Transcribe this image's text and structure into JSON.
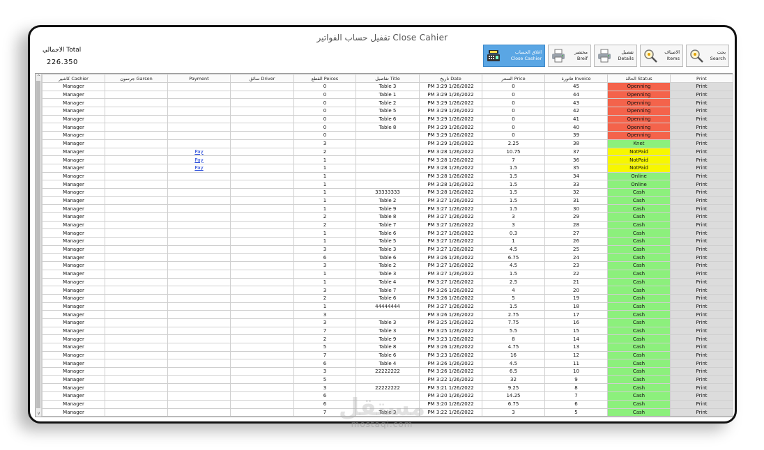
{
  "window": {
    "title": "تقفيل حساب الفواتير Close Cahier"
  },
  "total": {
    "label": "الاجمالي Total",
    "value": "226.350"
  },
  "toolbar": {
    "close_cashier": {
      "ar": "اغلاق الحساب",
      "en": "Close Cashier"
    },
    "brief": {
      "ar": "مختصر",
      "en": "Breif"
    },
    "details": {
      "ar": "تفصيل",
      "en": "Details"
    },
    "items": {
      "ar": "الاصناف",
      "en": "Items"
    },
    "search": {
      "ar": "بحث",
      "en": "Search"
    }
  },
  "scroll": {
    "up": "^",
    "down": "v"
  },
  "columns": [
    "كاشير Cashier",
    "جرسون Garson",
    "Payment",
    "سائق Driver",
    "القطع Peices",
    "تفاصيل Title",
    "تاريخ Date",
    "السعر Price",
    "فاتورة Invoice",
    "الحالة Status",
    "Print"
  ],
  "rows": [
    {
      "cashier": "Manager",
      "garson": "",
      "payment": "",
      "driver": "",
      "pieces": "0",
      "title": "Table 3",
      "date": "PM 3:29 1/26/2022",
      "price": "0",
      "invoice": "45",
      "status": "Openning",
      "print": "Print"
    },
    {
      "cashier": "Manager",
      "garson": "",
      "payment": "",
      "driver": "",
      "pieces": "0",
      "title": "Table 1",
      "date": "PM 3:29 1/26/2022",
      "price": "0",
      "invoice": "44",
      "status": "Openning",
      "print": "Print"
    },
    {
      "cashier": "Manager",
      "garson": "",
      "payment": "",
      "driver": "",
      "pieces": "0",
      "title": "Table 2",
      "date": "PM 3:29 1/26/2022",
      "price": "0",
      "invoice": "43",
      "status": "Openning",
      "print": "Print"
    },
    {
      "cashier": "Manager",
      "garson": "",
      "payment": "",
      "driver": "",
      "pieces": "0",
      "title": "Table 5",
      "date": "PM 3:29 1/26/2022",
      "price": "0",
      "invoice": "42",
      "status": "Openning",
      "print": "Print"
    },
    {
      "cashier": "Manager",
      "garson": "",
      "payment": "",
      "driver": "",
      "pieces": "0",
      "title": "Table 6",
      "date": "PM 3:29 1/26/2022",
      "price": "0",
      "invoice": "41",
      "status": "Openning",
      "print": "Print"
    },
    {
      "cashier": "Manager",
      "garson": "",
      "payment": "",
      "driver": "",
      "pieces": "0",
      "title": "Table 8",
      "date": "PM 3:29 1/26/2022",
      "price": "0",
      "invoice": "40",
      "status": "Openning",
      "print": "Print"
    },
    {
      "cashier": "Manager",
      "garson": "",
      "payment": "",
      "driver": "",
      "pieces": "0",
      "title": "",
      "date": "PM 3:29 1/26/2022",
      "price": "0",
      "invoice": "39",
      "status": "Openning",
      "print": "Print"
    },
    {
      "cashier": "Manager",
      "garson": "",
      "payment": "",
      "driver": "",
      "pieces": "3",
      "title": "",
      "date": "PM 3:29 1/26/2022",
      "price": "2.25",
      "invoice": "38",
      "status": "Knet",
      "print": "Print"
    },
    {
      "cashier": "Manager",
      "garson": "",
      "payment": "Pay",
      "driver": "",
      "pieces": "2",
      "title": "",
      "date": "PM 3:28 1/26/2022",
      "price": "10.75",
      "invoice": "37",
      "status": "NotPaid",
      "print": "Print"
    },
    {
      "cashier": "Manager",
      "garson": "",
      "payment": "Pay",
      "driver": "",
      "pieces": "1",
      "title": "",
      "date": "PM 3:28 1/26/2022",
      "price": "7",
      "invoice": "36",
      "status": "NotPaid",
      "print": "Print"
    },
    {
      "cashier": "Manager",
      "garson": "",
      "payment": "Pay",
      "driver": "",
      "pieces": "1",
      "title": "",
      "date": "PM 3:28 1/26/2022",
      "price": "1.5",
      "invoice": "35",
      "status": "NotPaid",
      "print": "Print"
    },
    {
      "cashier": "Manager",
      "garson": "",
      "payment": "",
      "driver": "",
      "pieces": "1",
      "title": "",
      "date": "PM 3:28 1/26/2022",
      "price": "1.5",
      "invoice": "34",
      "status": "Online",
      "print": "Print"
    },
    {
      "cashier": "Manager",
      "garson": "",
      "payment": "",
      "driver": "",
      "pieces": "1",
      "title": "",
      "date": "PM 3:28 1/26/2022",
      "price": "1.5",
      "invoice": "33",
      "status": "Online",
      "print": "Print"
    },
    {
      "cashier": "Manager",
      "garson": "",
      "payment": "",
      "driver": "",
      "pieces": "1",
      "title": "33333333",
      "date": "PM 3:28 1/26/2022",
      "price": "1.5",
      "invoice": "32",
      "status": "Cash",
      "print": "Print"
    },
    {
      "cashier": "Manager",
      "garson": "",
      "payment": "",
      "driver": "",
      "pieces": "1",
      "title": "Table 2",
      "date": "PM 3:27 1/26/2022",
      "price": "1.5",
      "invoice": "31",
      "status": "Cash",
      "print": "Print"
    },
    {
      "cashier": "Manager",
      "garson": "",
      "payment": "",
      "driver": "",
      "pieces": "1",
      "title": "Table 9",
      "date": "PM 3:27 1/26/2022",
      "price": "1.5",
      "invoice": "30",
      "status": "Cash",
      "print": "Print"
    },
    {
      "cashier": "Manager",
      "garson": "",
      "payment": "",
      "driver": "",
      "pieces": "2",
      "title": "Table 8",
      "date": "PM 3:27 1/26/2022",
      "price": "3",
      "invoice": "29",
      "status": "Cash",
      "print": "Print"
    },
    {
      "cashier": "Manager",
      "garson": "",
      "payment": "",
      "driver": "",
      "pieces": "2",
      "title": "Table 7",
      "date": "PM 3:27 1/26/2022",
      "price": "3",
      "invoice": "28",
      "status": "Cash",
      "print": "Print"
    },
    {
      "cashier": "Manager",
      "garson": "",
      "payment": "",
      "driver": "",
      "pieces": "1",
      "title": "Table 6",
      "date": "PM 3:27 1/26/2022",
      "price": "0.3",
      "invoice": "27",
      "status": "Cash",
      "print": "Print"
    },
    {
      "cashier": "Manager",
      "garson": "",
      "payment": "",
      "driver": "",
      "pieces": "1",
      "title": "Table 5",
      "date": "PM 3:27 1/26/2022",
      "price": "1",
      "invoice": "26",
      "status": "Cash",
      "print": "Print"
    },
    {
      "cashier": "Manager",
      "garson": "",
      "payment": "",
      "driver": "",
      "pieces": "3",
      "title": "Table 3",
      "date": "PM 3:27 1/26/2022",
      "price": "4.5",
      "invoice": "25",
      "status": "Cash",
      "print": "Print"
    },
    {
      "cashier": "Manager",
      "garson": "",
      "payment": "",
      "driver": "",
      "pieces": "6",
      "title": "Table 6",
      "date": "PM 3:26 1/26/2022",
      "price": "6.75",
      "invoice": "24",
      "status": "Cash",
      "print": "Print"
    },
    {
      "cashier": "Manager",
      "garson": "",
      "payment": "",
      "driver": "",
      "pieces": "3",
      "title": "Table 2",
      "date": "PM 3:27 1/26/2022",
      "price": "4.5",
      "invoice": "23",
      "status": "Cash",
      "print": "Print"
    },
    {
      "cashier": "Manager",
      "garson": "",
      "payment": "",
      "driver": "",
      "pieces": "1",
      "title": "Table 3",
      "date": "PM 3:27 1/26/2022",
      "price": "1.5",
      "invoice": "22",
      "status": "Cash",
      "print": "Print"
    },
    {
      "cashier": "Manager",
      "garson": "",
      "payment": "",
      "driver": "",
      "pieces": "1",
      "title": "Table 4",
      "date": "PM 3:27 1/26/2022",
      "price": "2.5",
      "invoice": "21",
      "status": "Cash",
      "print": "Print"
    },
    {
      "cashier": "Manager",
      "garson": "",
      "payment": "",
      "driver": "",
      "pieces": "3",
      "title": "Table 7",
      "date": "PM 3:26 1/26/2022",
      "price": "4",
      "invoice": "20",
      "status": "Cash",
      "print": "Print"
    },
    {
      "cashier": "Manager",
      "garson": "",
      "payment": "",
      "driver": "",
      "pieces": "2",
      "title": "Table 6",
      "date": "PM 3:26 1/26/2022",
      "price": "5",
      "invoice": "19",
      "status": "Cash",
      "print": "Print"
    },
    {
      "cashier": "Manager",
      "garson": "",
      "payment": "",
      "driver": "",
      "pieces": "1",
      "title": "44444444",
      "date": "PM 3:27 1/26/2022",
      "price": "1.5",
      "invoice": "18",
      "status": "Cash",
      "print": "Print"
    },
    {
      "cashier": "Manager",
      "garson": "",
      "payment": "",
      "driver": "",
      "pieces": "3",
      "title": "",
      "date": "PM 3:26 1/26/2022",
      "price": "2.75",
      "invoice": "17",
      "status": "Cash",
      "print": "Print"
    },
    {
      "cashier": "Manager",
      "garson": "",
      "payment": "",
      "driver": "",
      "pieces": "3",
      "title": "Table 3",
      "date": "PM 3:25 1/26/2022",
      "price": "7.75",
      "invoice": "16",
      "status": "Cash",
      "print": "Print"
    },
    {
      "cashier": "Manager",
      "garson": "",
      "payment": "",
      "driver": "",
      "pieces": "7",
      "title": "Table 3",
      "date": "PM 3:25 1/26/2022",
      "price": "5.5",
      "invoice": "15",
      "status": "Cash",
      "print": "Print"
    },
    {
      "cashier": "Manager",
      "garson": "",
      "payment": "",
      "driver": "",
      "pieces": "2",
      "title": "Table 9",
      "date": "PM 3:23 1/26/2022",
      "price": "8",
      "invoice": "14",
      "status": "Cash",
      "print": "Print"
    },
    {
      "cashier": "Manager",
      "garson": "",
      "payment": "",
      "driver": "",
      "pieces": "5",
      "title": "Table 8",
      "date": "PM 3:26 1/26/2022",
      "price": "4.75",
      "invoice": "13",
      "status": "Cash",
      "print": "Print"
    },
    {
      "cashier": "Manager",
      "garson": "",
      "payment": "",
      "driver": "",
      "pieces": "7",
      "title": "Table 6",
      "date": "PM 3:23 1/26/2022",
      "price": "16",
      "invoice": "12",
      "status": "Cash",
      "print": "Print"
    },
    {
      "cashier": "Manager",
      "garson": "",
      "payment": "",
      "driver": "",
      "pieces": "6",
      "title": "Table 4",
      "date": "PM 3:26 1/26/2022",
      "price": "4.5",
      "invoice": "11",
      "status": "Cash",
      "print": "Print"
    },
    {
      "cashier": "Manager",
      "garson": "",
      "payment": "",
      "driver": "",
      "pieces": "3",
      "title": "22222222",
      "date": "PM 3:26 1/26/2022",
      "price": "6.5",
      "invoice": "10",
      "status": "Cash",
      "print": "Print"
    },
    {
      "cashier": "Manager",
      "garson": "",
      "payment": "",
      "driver": "",
      "pieces": "5",
      "title": "",
      "date": "PM 3:22 1/26/2022",
      "price": "32",
      "invoice": "9",
      "status": "Cash",
      "print": "Print"
    },
    {
      "cashier": "Manager",
      "garson": "",
      "payment": "",
      "driver": "",
      "pieces": "3",
      "title": "22222222",
      "date": "PM 3:21 1/26/2022",
      "price": "9.25",
      "invoice": "8",
      "status": "Cash",
      "print": "Print"
    },
    {
      "cashier": "Manager",
      "garson": "",
      "payment": "",
      "driver": "",
      "pieces": "6",
      "title": "",
      "date": "PM 3:20 1/26/2022",
      "price": "14.25",
      "invoice": "7",
      "status": "Cash",
      "print": "Print"
    },
    {
      "cashier": "Manager",
      "garson": "",
      "payment": "",
      "driver": "",
      "pieces": "6",
      "title": "",
      "date": "PM 3:20 1/26/2022",
      "price": "6.75",
      "invoice": "6",
      "status": "Cash",
      "print": "Print"
    },
    {
      "cashier": "Manager",
      "garson": "",
      "payment": "",
      "driver": "",
      "pieces": "7",
      "title": "Table 3",
      "date": "PM 3:22 1/26/2022",
      "price": "3",
      "invoice": "5",
      "status": "Cash",
      "print": "Print"
    }
  ],
  "watermark": {
    "arabic": "مستقل",
    "latin": "mostaql.com"
  },
  "colors": {
    "opening": "#f4634b",
    "paid": "#8cf07c",
    "notpaid": "#f7f700",
    "accent": "#5aa6e4"
  },
  "icons": {
    "close_cashier": "cash-register-icon",
    "brief": "printer-icon",
    "details": "printer-icon",
    "items": "magnifier-icon",
    "search": "magnifier-icon"
  }
}
